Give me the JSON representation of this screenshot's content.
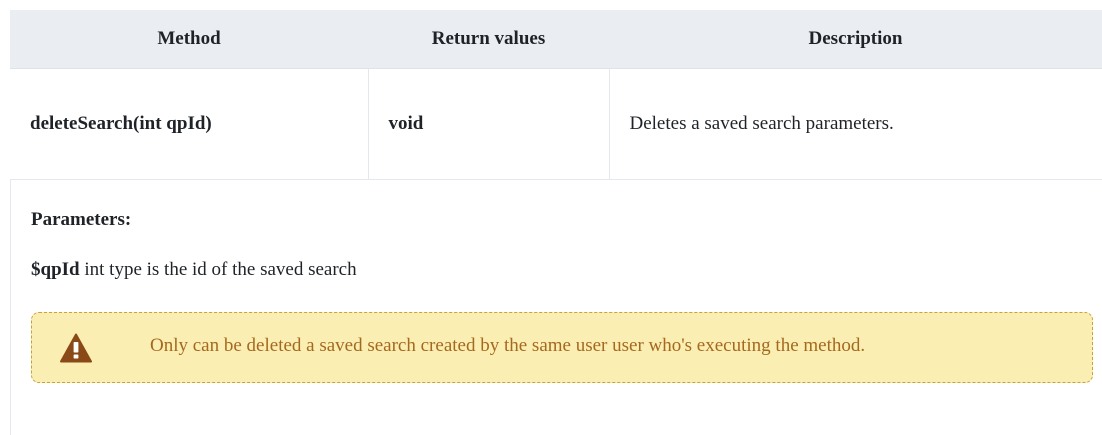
{
  "table": {
    "headers": {
      "method": "Method",
      "return_values": "Return values",
      "description": "Description"
    },
    "row": {
      "method": "deleteSearch(int qpId)",
      "return_value": "void",
      "description": "Deletes a saved search parameters."
    }
  },
  "parameters": {
    "title": "Parameters:",
    "items": [
      {
        "name": "$qpId",
        "text": " int type is the id of the saved search"
      }
    ]
  },
  "warning": {
    "icon": "warning-triangle-icon",
    "text": "Only can be deleted a saved search created by the same user user who's executing the method.",
    "colors": {
      "background": "#fbeeb3",
      "border": "#c9a33a",
      "text": "#a4691f",
      "icon": "#8a4a17"
    }
  },
  "colors": {
    "header_background": "#eaeef3",
    "border": "#e4e7eb"
  }
}
